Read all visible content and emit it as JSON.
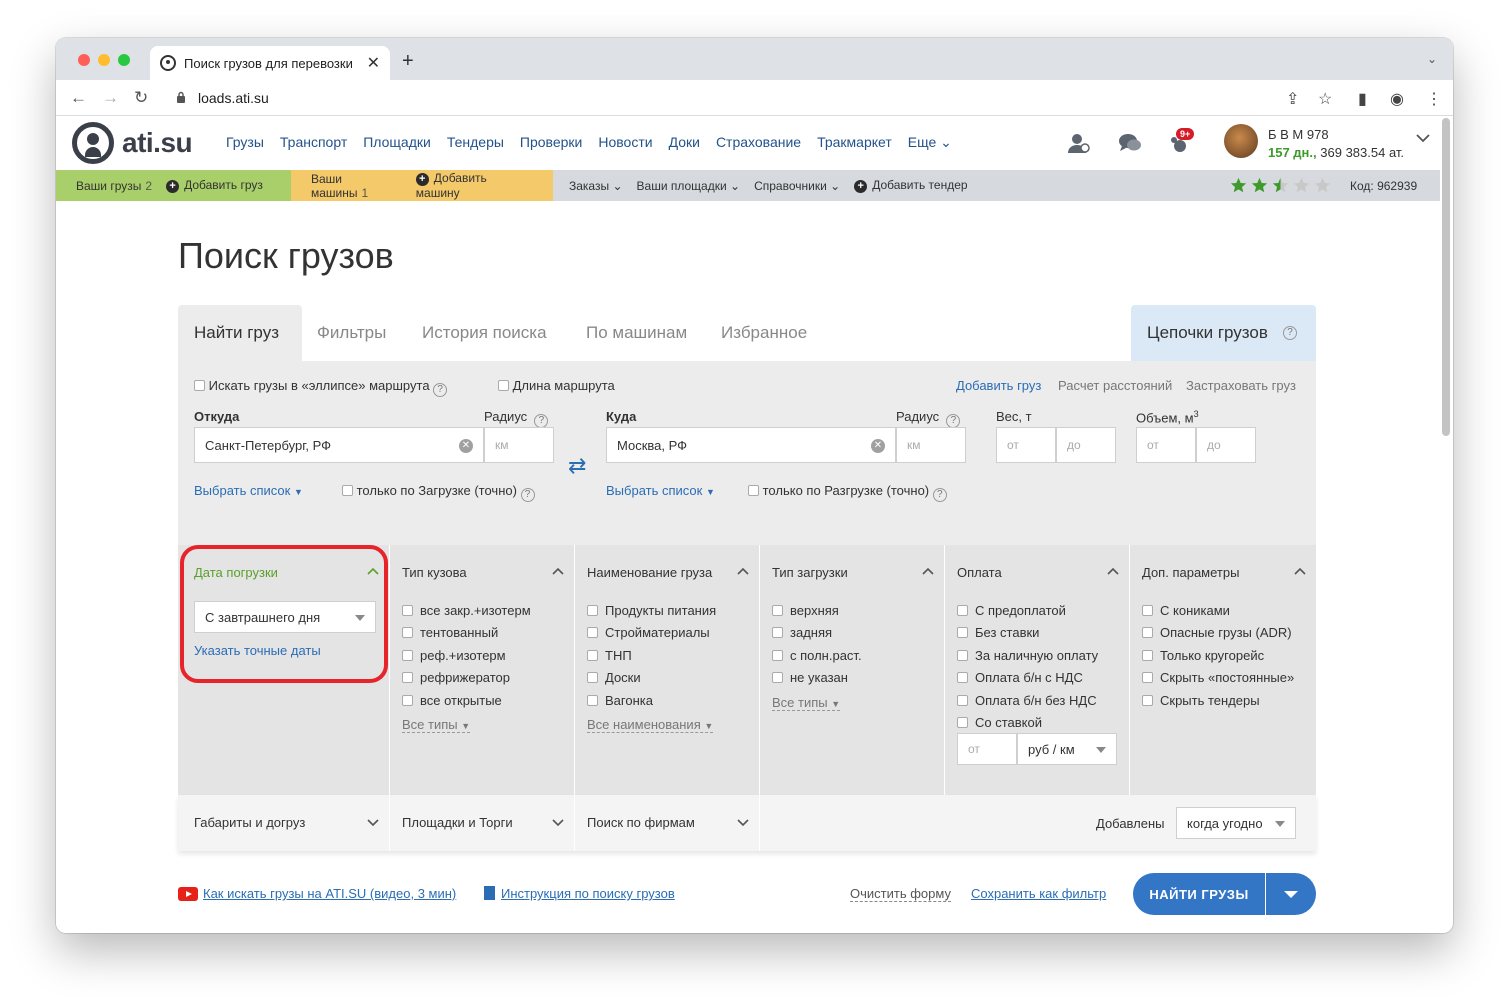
{
  "browser": {
    "tab_title": "Поиск грузов для перевозки",
    "url": "loads.ati.su"
  },
  "header": {
    "logo": "ati.su",
    "nav": [
      "Грузы",
      "Транспорт",
      "Площадки",
      "Тендеры",
      "Проверки",
      "Новости",
      "Доки",
      "Страхование",
      "Тракмаркет",
      "Еще"
    ],
    "badge": "9+",
    "user_name": "Б В М 978",
    "user_days": "157 дн.,",
    "user_balance": "369 383.54 ат."
  },
  "subbar": {
    "your_loads": "Ваши грузы",
    "your_loads_count": "2",
    "add_load": "Добавить груз",
    "your_trucks": "Ваши машины",
    "your_trucks_count": "1",
    "add_truck": "Добавить машину",
    "orders": "Заказы",
    "your_platforms": "Ваши площадки",
    "directories": "Справочники",
    "add_tender": "Добавить тендер",
    "rating": 2.5,
    "code": "Код: 962939"
  },
  "page": {
    "title": "Поиск грузов",
    "tabs": [
      "Найти груз",
      "Фильтры",
      "История поиска",
      "По машинам",
      "Избранное"
    ],
    "chain_tab": "Цепочки грузов",
    "ellipse_label": "Искать грузы в «эллипсе» маршрута",
    "route_length_label": "Длина маршрута",
    "links_top": [
      "Добавить груз",
      "Расчет расстояний",
      "Застраховать груз"
    ],
    "from_label": "Откуда",
    "to_label": "Куда",
    "radius_label": "Радиус",
    "weight_label": "Вес, т",
    "volume_label": "Объем, м",
    "volume_sup": "3",
    "from_value": "Санкт-Петербург, РФ",
    "to_value": "Москва, РФ",
    "km_ph": "км",
    "from_ph": "от",
    "to_ph": "до",
    "choose_list": "Выбрать список",
    "only_loading": "только по Загрузке (точно)",
    "only_unloading": "только по Разгрузке (точно)"
  },
  "columns": {
    "date": {
      "title": "Дата погрузки",
      "select": "С завтрашнего дня",
      "exact": "Указать точные даты"
    },
    "body": {
      "title": "Тип кузова",
      "options": [
        "все закр.+изотерм",
        "тентованный",
        "реф.+изотерм",
        "рефрижератор",
        "все открытые"
      ],
      "more": "Все типы"
    },
    "cargo": {
      "title": "Наименование груза",
      "options": [
        "Продукты питания",
        "Стройматериалы",
        "ТНП",
        "Доски",
        "Вагонка"
      ],
      "more": "Все наименования"
    },
    "loading": {
      "title": "Тип загрузки",
      "options": [
        "верхняя",
        "задняя",
        "с полн.раст.",
        "не указан"
      ],
      "more": "Все типы"
    },
    "payment": {
      "title": "Оплата",
      "options": [
        "С предоплатой",
        "Без ставки",
        "За наличную оплату",
        "Оплата б/н с НДС",
        "Оплата б/н без НДС",
        "Со ставкой"
      ],
      "rate_ph": "от",
      "rate_unit": "руб / км"
    },
    "extra": {
      "title": "Доп. параметры",
      "options": [
        "С кониками",
        "Опасные грузы (ADR)",
        "Только кругорейс",
        "Скрыть «постоянные»",
        "Скрыть тендеры"
      ]
    }
  },
  "bottom": {
    "dims": "Габариты и догруз",
    "platforms": "Площадки и Торги",
    "firms": "Поиск по фирмам",
    "added_label": "Добавлены",
    "added_value": "когда угодно"
  },
  "footer": {
    "video_link": "Как искать грузы на ATI.SU (видео, 3 мин)",
    "instruction_link": "Инструкция по поиску грузов",
    "clear": "Очистить форму",
    "save_filter": "Сохранить как фильтр",
    "find_button": "НАЙТИ ГРУЗЫ"
  },
  "colors": {
    "accent": "#3476c6",
    "highlight": "#e6242a",
    "green_bar": "#a9cf6a",
    "yellow_bar": "#f3c96a",
    "active_col_title": "#5aa02c"
  }
}
